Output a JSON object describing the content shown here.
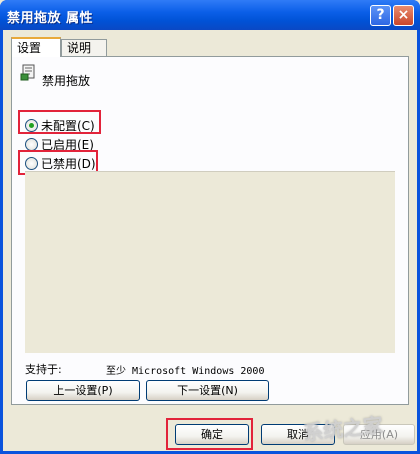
{
  "window": {
    "title": "禁用拖放 属性",
    "help_label": "?",
    "close_label": "×"
  },
  "tabs": [
    {
      "label": "设置"
    },
    {
      "label": "说明"
    }
  ],
  "policy": {
    "icon": "policy-scroll-icon",
    "name": "禁用拖放"
  },
  "options": [
    {
      "label": "未配置(C)",
      "checked": true
    },
    {
      "label": "已启用(E)",
      "checked": false
    },
    {
      "label": "已禁用(D)",
      "checked": false
    }
  ],
  "support": {
    "label": "支持于:",
    "value": "至少 Microsoft Windows 2000"
  },
  "nav": {
    "prev_label": "上一设置(P)",
    "next_label": "下一设置(N)"
  },
  "actions": {
    "ok_label": "确定",
    "cancel_label": "取消",
    "apply_label": "应用(A)"
  },
  "colors": {
    "highlight": "#e2233a",
    "title_bar": "#0b5fe8",
    "dialog_bg": "#ece9d8"
  },
  "watermark": {
    "logo_text": "系统之家"
  }
}
